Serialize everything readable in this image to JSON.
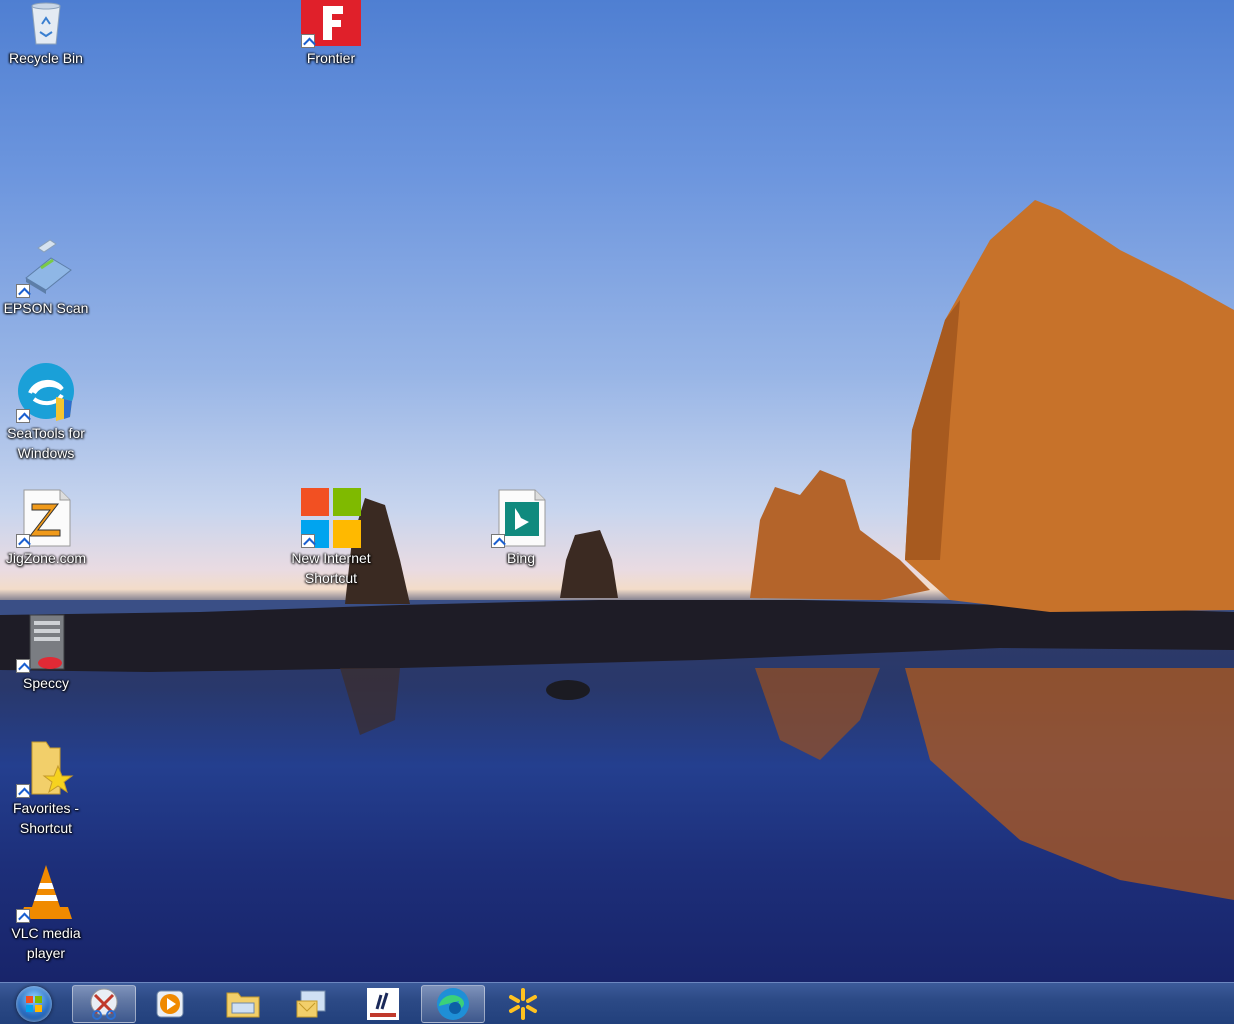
{
  "desktop_icons": [
    {
      "name": "recycle-bin",
      "label": "Recycle Bin",
      "icon": "recycle-bin-icon"
    },
    {
      "name": "frontier",
      "label": "Frontier",
      "icon": "frontier-icon"
    },
    {
      "name": "epson-scan",
      "label": "EPSON Scan",
      "icon": "scanner-icon"
    },
    {
      "name": "seatools",
      "label": "SeaTools for\nWindows",
      "icon": "seatools-icon"
    },
    {
      "name": "jigzone",
      "label": "JigZone.com",
      "icon": "jigzone-icon"
    },
    {
      "name": "new-internet-shortcut",
      "label": "New Internet\nShortcut",
      "icon": "microsoft-logo-icon"
    },
    {
      "name": "bing",
      "label": "Bing",
      "icon": "bing-icon"
    },
    {
      "name": "speccy",
      "label": "Speccy",
      "icon": "speccy-icon"
    },
    {
      "name": "favorites",
      "label": "Favorites -\nShortcut",
      "icon": "favorites-folder-icon"
    },
    {
      "name": "vlc",
      "label": "VLC media\nplayer",
      "icon": "vlc-icon"
    }
  ],
  "taskbar": {
    "start": "start-orb-icon",
    "pinned": [
      "snipping-tool-icon",
      "media-player-icon",
      "file-explorer-icon",
      "outlook-icon",
      "app-tile-icon",
      "edge-icon",
      "walmart-icon"
    ]
  },
  "colors": {
    "taskbar": "#2c4a86",
    "sky": "#6d96de",
    "water": "#243f8f"
  }
}
